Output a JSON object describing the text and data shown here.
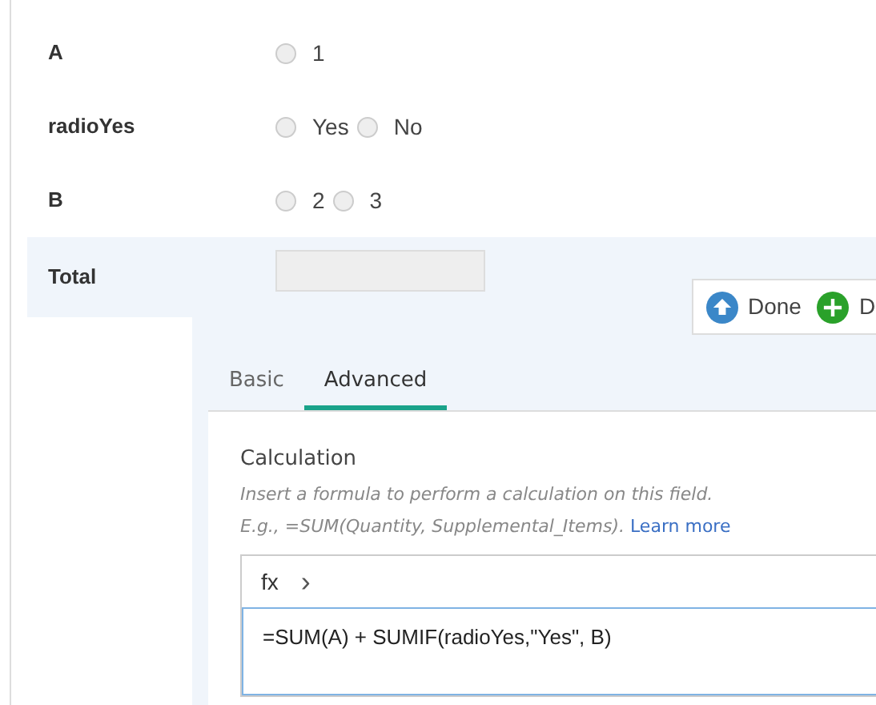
{
  "fields": [
    {
      "label": "A",
      "options": [
        {
          "label": "1",
          "selected": false
        }
      ]
    },
    {
      "label": "radioYes",
      "options": [
        {
          "label": "Yes",
          "selected": false
        },
        {
          "label": "No",
          "selected": false
        }
      ]
    },
    {
      "label": "B",
      "options": [
        {
          "label": "2",
          "selected": false
        },
        {
          "label": "3",
          "selected": false
        }
      ]
    }
  ],
  "total": {
    "label": "Total"
  },
  "toolbar": [
    {
      "kind": "done",
      "label": "Done"
    },
    {
      "kind": "add",
      "label": "D"
    }
  ],
  "tabs": [
    {
      "label": "Basic",
      "selected": false
    },
    {
      "label": "Advanced",
      "selected": true
    }
  ],
  "calculation": {
    "heading": "Calculation",
    "help": "Insert a formula to perform a calculation on this field.",
    "example": "E.g., =SUM(Quantity, Supplemental_Items).",
    "link": "Learn more",
    "fx": "fx",
    "chevron": "›",
    "formula": "=SUM(A) + SUMIF(radioYes,\"Yes\", B)"
  }
}
